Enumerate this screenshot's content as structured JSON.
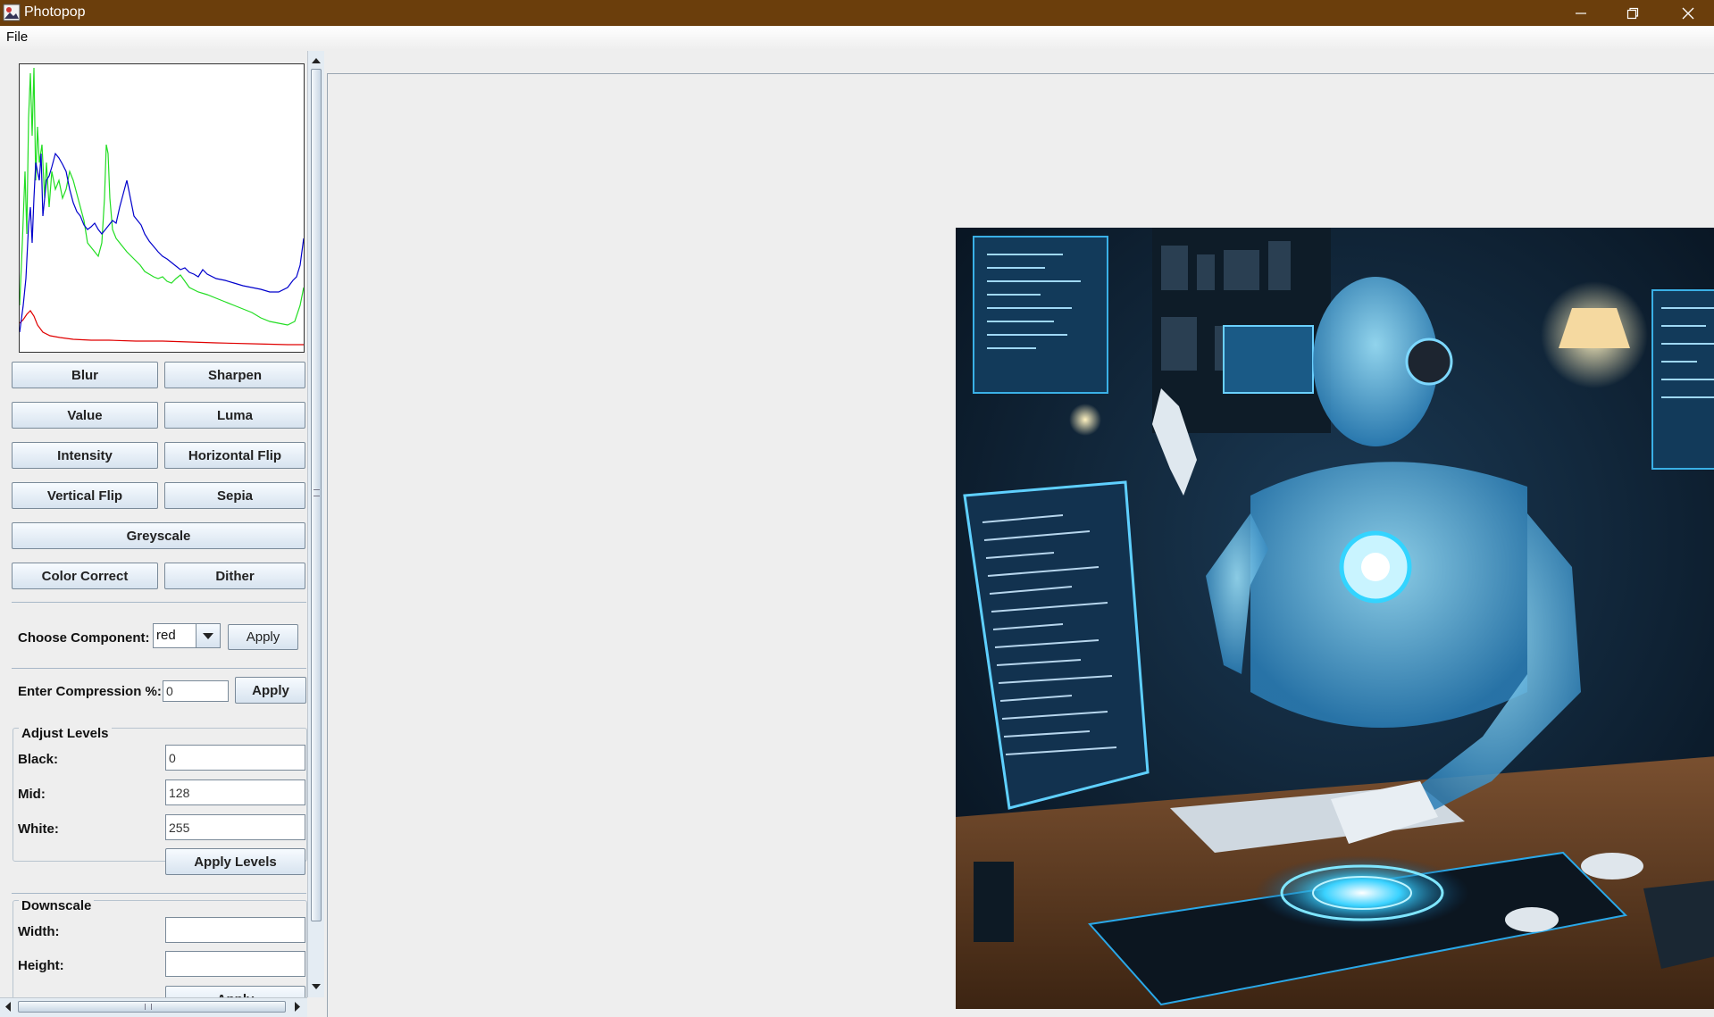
{
  "window": {
    "title": "Photopop"
  },
  "menu": {
    "file": "File"
  },
  "filters": {
    "blur": "Blur",
    "sharpen": "Sharpen",
    "value": "Value",
    "luma": "Luma",
    "intensity": "Intensity",
    "horizontal_flip": "Horizontal Flip",
    "vertical_flip": "Vertical Flip",
    "sepia": "Sepia",
    "greyscale": "Greyscale",
    "color_correct": "Color Correct",
    "dither": "Dither"
  },
  "component": {
    "label": "Choose Component:",
    "selected": "red",
    "apply": "Apply"
  },
  "compression": {
    "label": "Enter Compression %:",
    "value": "0",
    "apply": "Apply"
  },
  "levels": {
    "title": "Adjust Levels",
    "black_label": "Black:",
    "black_value": "0",
    "mid_label": "Mid:",
    "mid_value": "128",
    "white_label": "White:",
    "white_value": "255",
    "apply": "Apply Levels"
  },
  "downscale": {
    "title": "Downscale",
    "width_label": "Width:",
    "width_value": "",
    "height_label": "Height:",
    "height_value": "",
    "apply": "Apply"
  },
  "histogram_colors": {
    "red": "#e00000",
    "green": "#22dd22",
    "blue": "#0000cc"
  },
  "colors": {
    "titlebar": "#6b3e0c",
    "panel": "#eeeeee"
  }
}
